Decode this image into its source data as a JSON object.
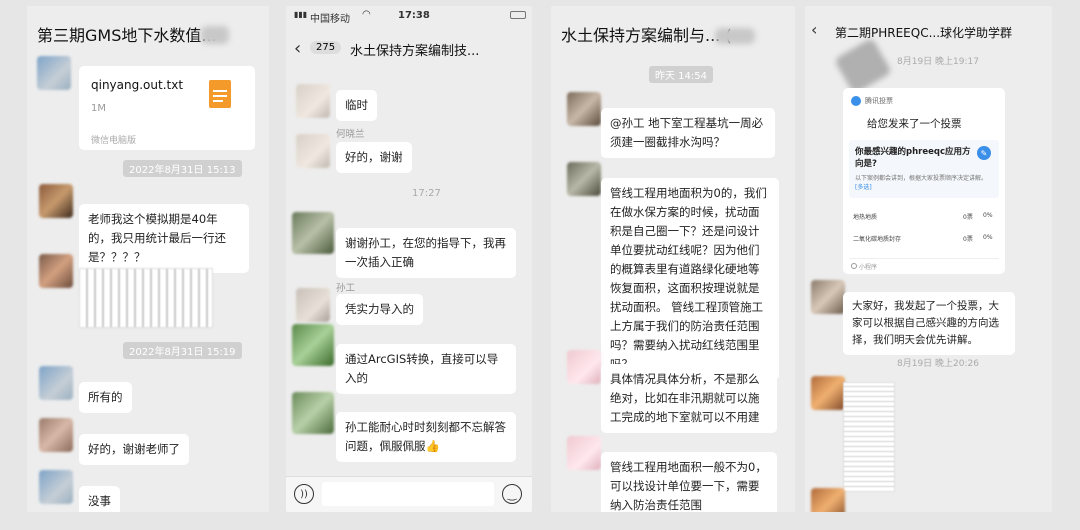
{
  "p1": {
    "title": "第三期GMS地下水数值...",
    "file_name": "qinyang.out.txt",
    "file_size": "1M",
    "file_source": "微信电脑版",
    "time1": "2022年8月31日 15:13",
    "msg1": "老师我这个模拟期是40年的，我只用统计最后一行还是？？？？",
    "time2": "2022年8月31日 15:19",
    "msg2": "所有的",
    "msg3": "好的，谢谢老师了",
    "msg4": "没事"
  },
  "p2": {
    "carrier": "中国移动",
    "clock": "17:38",
    "back_count": "275",
    "title": "水土保持方案编制技...",
    "msg1": "临时",
    "sender1": "何晓兰",
    "msg2": "好的，谢谢",
    "time1": "17:27",
    "msg3": "谢谢孙工，在您的指导下，我再一次插入正确",
    "sender2": "孙工",
    "msg4": "凭实力导入的",
    "msg5": "通过ArcGIS转换，直接可以导入的",
    "msg6": "孙工能耐心时时刻刻都不忘解答问题，佩服佩服👍"
  },
  "p3": {
    "title": "水土保持方案编制与...",
    "title_suffix": "(",
    "time1": "昨天 14:54",
    "msg1": "@孙工 地下室工程基坑一周必须建一圈截排水沟吗？",
    "msg2": "管线工程用地面积为0的，我们在做水保方案的时候，扰动面积是自己圈一下？还是问设计单位要扰动红线呢？因为他们的概算表里有道路绿化硬地等恢复面积，这面积按理说就是扰动面积。    管线工程顶管施工上方属于我们的防治责任范围吗？需要纳入扰动红线范围里吗？",
    "msg3": "具体情况具体分析，不是那么绝对，比如在非汛期就可以施工完成的地下室就可以不用建",
    "msg4": "管线工程用地面积一般不为0，可以找设计单位要一下，需要纳入防治责任范围"
  },
  "p4": {
    "title": "第二期PHREEQC...球化学助学群",
    "time1": "8月19日 晚上19:17",
    "app_name": "腾讯投票",
    "vote_intro": "给您发来了一个投票",
    "vote_question": "你最感兴趣的phreeqc应用方向是?",
    "vote_desc": "以下案例都会讲到，根据大家投票顺序决定讲解。",
    "vote_more": "[多选]",
    "opt1": "地热地质",
    "opt1_count": "0票",
    "opt1_pct": "0%",
    "opt2": "二氧化碳地质封存",
    "opt2_count": "0票",
    "opt2_pct": "0%",
    "mini_program": "小程序",
    "msg1": "大家好，我发起了一个投票，大家可以根据自己感兴趣的方向选择，我们明天会优先讲解。",
    "time2": "8月19日 晚上20:26"
  }
}
